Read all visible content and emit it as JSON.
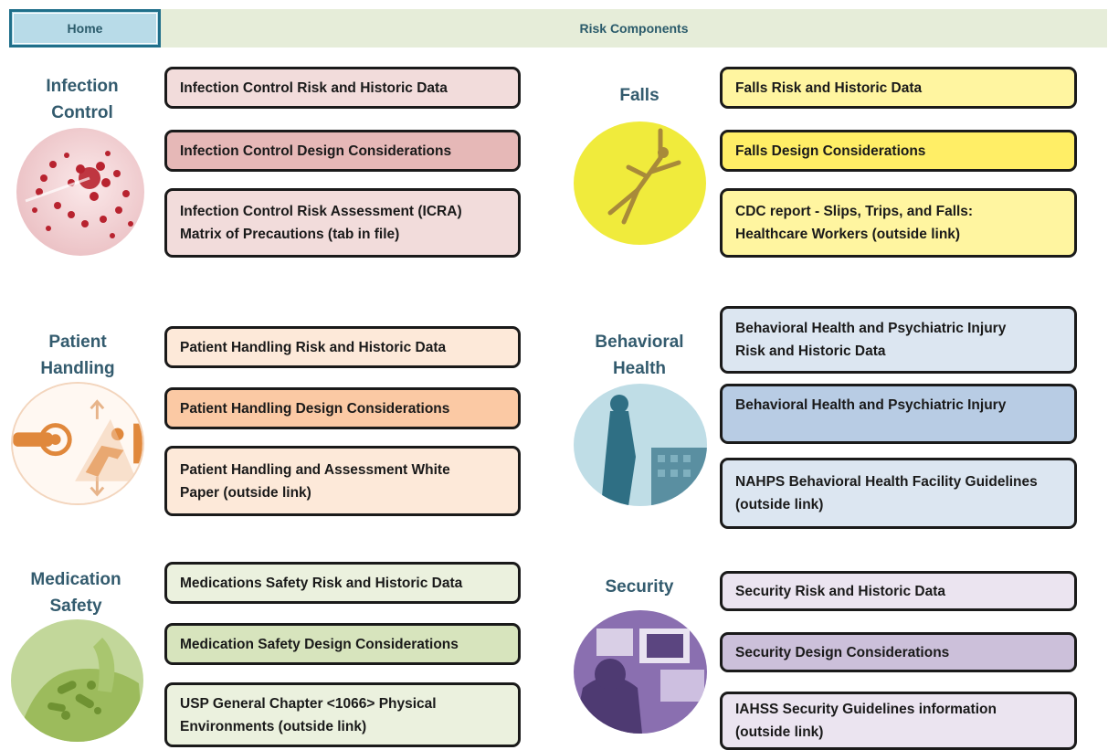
{
  "header": {
    "home_label": "Home",
    "title": "Risk Components"
  },
  "categories": {
    "infection_control": {
      "title": "Infection\nControl",
      "links": [
        {
          "label": "Infection Control Risk and Historic Data",
          "color": "#f2dcdb"
        },
        {
          "label": "Infection Control Design Considerations",
          "color": "#e6b8b7"
        },
        {
          "label": "Infection Control Risk Assessment (ICRA)\nMatrix of Precautions (tab in file)",
          "color": "#f2dcdb"
        }
      ]
    },
    "falls": {
      "title": "Falls",
      "links": [
        {
          "label": "Falls Risk and Historic Data",
          "color": "#fff5a0"
        },
        {
          "label": "Falls Design Considerations",
          "color": "#ffee66"
        },
        {
          "label": "CDC report - Slips, Trips, and Falls:\nHealthcare Workers (outside link)",
          "color": "#fff5a0"
        }
      ]
    },
    "patient_handling": {
      "title": "Patient\nHandling",
      "links": [
        {
          "label": "Patient Handling Risk and Historic Data",
          "color": "#fde9d9"
        },
        {
          "label": "Patient Handling  Design Considerations",
          "color": "#fbc9a4"
        },
        {
          "label": "Patient Handling and Assessment White\nPaper (outside link)",
          "color": "#fde9d9"
        }
      ]
    },
    "behavioral_health": {
      "title": "Behavioral\nHealth",
      "links": [
        {
          "label": "Behavioral Health and Psychiatric Injury\nRisk and Historic Data",
          "color": "#dce6f1"
        },
        {
          "label": "Behavioral Health and Psychiatric Injury",
          "color": "#b8cce4"
        },
        {
          "label": "NAHPS Behavioral Health Facility Guidelines\n(outside link)",
          "color": "#dce6f1"
        }
      ]
    },
    "medication_safety": {
      "title": "Medication\nSafety",
      "links": [
        {
          "label": "Medications Safety Risk and Historic Data",
          "color": "#ebf1de"
        },
        {
          "label": "Medication Safety Design Considerations",
          "color": "#d7e4bd"
        },
        {
          "label": "USP General Chapter <1066> Physical\nEnvironments (outside link)",
          "color": "#ebf1de"
        }
      ]
    },
    "security": {
      "title": "Security",
      "links": [
        {
          "label": "Security Risk and Historic Data",
          "color": "#ebe4f0"
        },
        {
          "label": "Security Design Considerations",
          "color": "#ccc0da"
        },
        {
          "label": "IAHSS Security Guidelines information\n(outside link)",
          "color": "#ebe4f0"
        }
      ]
    }
  },
  "icons": {
    "infection_control": "bacteria-icon",
    "falls": "falling-person-icon",
    "patient_handling": "patient-handling-icon",
    "behavioral_health": "behavioral-health-icon",
    "medication_safety": "medication-pills-icon",
    "security": "security-monitor-icon"
  }
}
